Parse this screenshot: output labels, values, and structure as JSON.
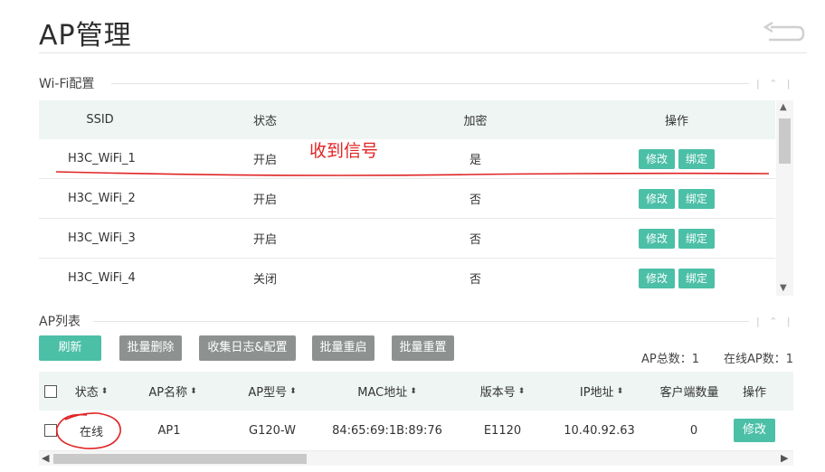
{
  "page": {
    "title": "AP管理"
  },
  "wifi": {
    "section_title": "Wi-Fi配置",
    "headers": {
      "ssid": "SSID",
      "state": "状态",
      "encryption": "加密",
      "ops": "操作"
    },
    "rows": [
      {
        "ssid": "H3C_WiFi_1",
        "state": "开启",
        "encryption": "是",
        "edit": "修改",
        "bind": "绑定"
      },
      {
        "ssid": "H3C_WiFi_2",
        "state": "开启",
        "encryption": "否",
        "edit": "修改",
        "bind": "绑定"
      },
      {
        "ssid": "H3C_WiFi_3",
        "state": "开启",
        "encryption": "否",
        "edit": "修改",
        "bind": "绑定"
      },
      {
        "ssid": "H3C_WiFi_4",
        "state": "关闭",
        "encryption": "否",
        "edit": "修改",
        "bind": "绑定"
      }
    ]
  },
  "annotation": {
    "text": "收到信号",
    "color": "#e02424"
  },
  "ap_list": {
    "section_title": "AP列表",
    "buttons": {
      "refresh": "刷新",
      "batch_delete": "批量删除",
      "collect_logs": "收集日志&配置",
      "batch_restart": "批量重启",
      "batch_reset": "批量重置"
    },
    "stats": {
      "total": "AP总数：1",
      "online": "在线AP数：1"
    },
    "headers": {
      "state": "状态",
      "name": "AP名称",
      "model": "AP型号",
      "mac": "MAC地址",
      "version": "版本号",
      "ip": "IP地址",
      "clients": "客户端数量",
      "ops": "操作"
    },
    "rows": [
      {
        "state": "在线",
        "name": "AP1",
        "model": "G120-W",
        "mac": "84:65:69:1B:89:76",
        "version": "E1120",
        "ip": "10.40.92.63",
        "clients": "0",
        "edit": "修改"
      }
    ]
  },
  "colors": {
    "accent": "#4cbfa7",
    "gray_button": "#8d9291",
    "header_bg": "#eef5f3"
  },
  "icons": {
    "back": "back-arrow-icon",
    "sort": "sort-icon"
  }
}
